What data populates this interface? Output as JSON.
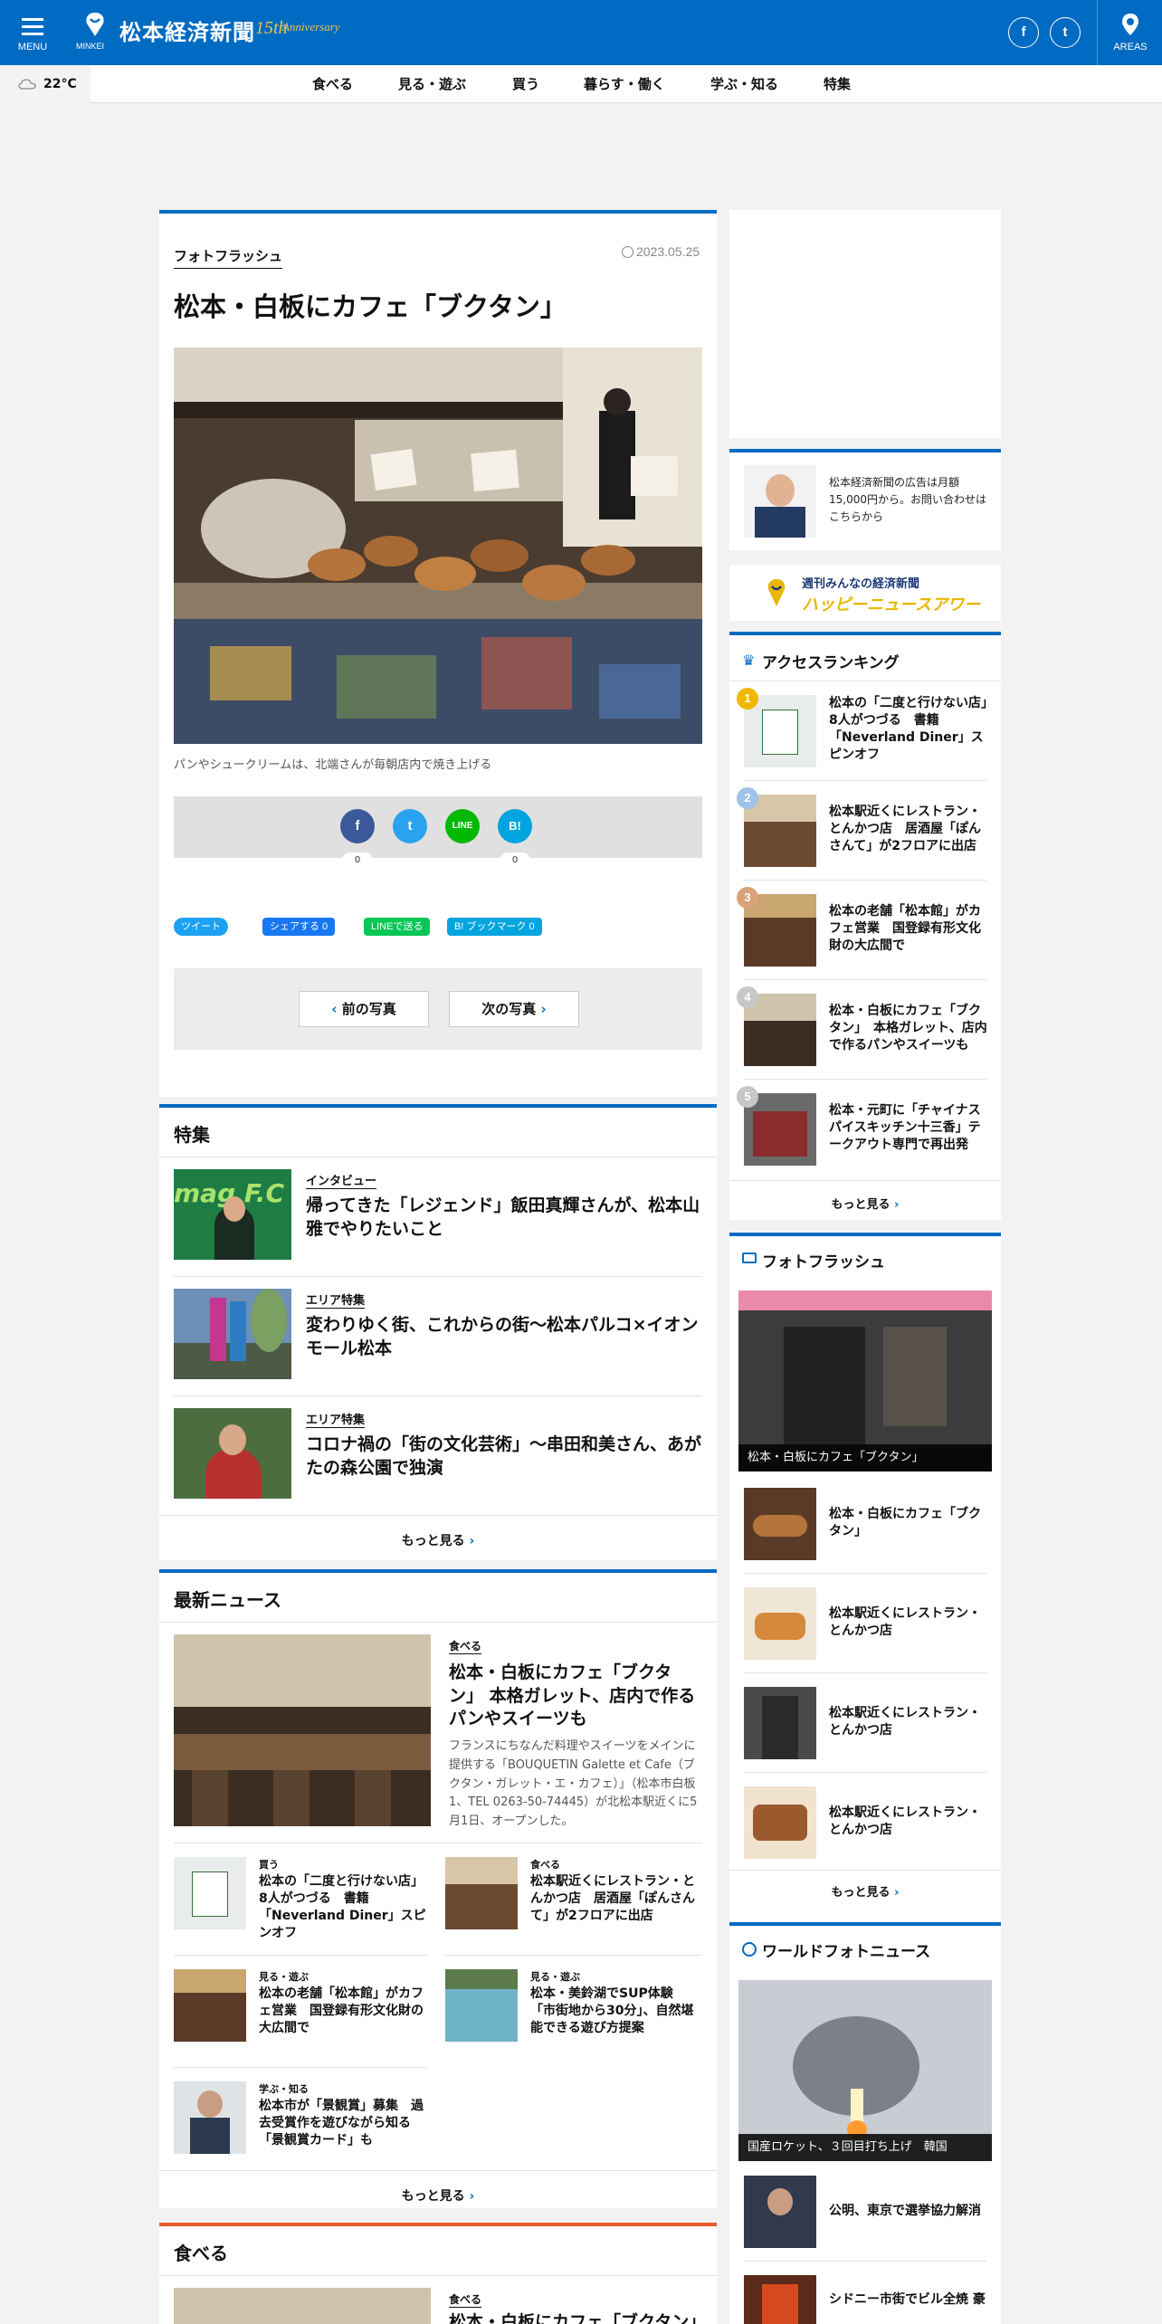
{
  "header": {
    "menu_label": "MENU",
    "brand": "MINKEI",
    "site_title": "松本経済新聞",
    "anniv_num": "15th",
    "anniv_text": "Anniversary",
    "facebook": "f",
    "twitter": "t",
    "areas_label": "AREAS",
    "color": "#006bc2"
  },
  "nav": {
    "weather": "22°C",
    "items": [
      "食べる",
      "見る・遊ぶ",
      "買う",
      "暮らす・働く",
      "学ぶ・知る",
      "特集"
    ]
  },
  "article": {
    "kicker": "フォトフラッシュ",
    "date": "2023.05.25",
    "title": "松本・白板にカフェ「ブクタン」",
    "caption": "パンやシュークリームは、北端さんが毎朝店内で焼き上げる",
    "share": {
      "facebook": "f",
      "twitter": "t",
      "line": "LINE",
      "hatena": "B!",
      "fb_count": "0",
      "hatena_count": "0"
    },
    "chips": {
      "tweet": "ツイート",
      "fb_share": "シェアする 0",
      "line_send": "LINEで送る",
      "bookmark": "B! ブックマーク  0"
    },
    "prev_label": "前の写真",
    "next_label": "次の写真"
  },
  "tokushu": {
    "title": "特集",
    "items": [
      {
        "tag": "インタビュー",
        "title": "帰ってきた「レジェンド」飯田真輝さんが、松本山雅でやりたいこと"
      },
      {
        "tag": "エリア特集",
        "title": "変わりゆく街、これからの街～松本パルコ×イオンモール松本"
      },
      {
        "tag": "エリア特集",
        "title": "コロナ禍の「街の文化芸術」～串田和美さん、あがたの森公園で独演"
      }
    ],
    "more": "もっと見る"
  },
  "news": {
    "title": "最新ニュース",
    "lead": {
      "tag": "食べる",
      "title": "松本・白板にカフェ「ブクタン」 本格ガレット、店内で作るパンやスイーツも",
      "body": "フランスにちなんだ料理やスイーツをメインに提供する「BOUQUETIN Galette et Cafe（ブクタン・ガレット・エ・カフェ）」（松本市白板1、TEL 0263-50-74445）が北松本駅近くに5月1日、オープンした。"
    },
    "grid": [
      {
        "tag": "買う",
        "title": "松本の「二度と行けない店」8人がつづる　書籍「Neverland Diner」スピンオフ"
      },
      {
        "tag": "食べる",
        "title": "松本駅近くにレストラン・とんかつ店　居酒屋「ぽんさんて」が2フロアに出店"
      },
      {
        "tag": "見る・遊ぶ",
        "title": "松本の老舗「松本館」がカフェ営業　国登録有形文化財の大広間で"
      },
      {
        "tag": "見る・遊ぶ",
        "title": "松本・美鈴湖でSUP体験　「市街地から30分」、自然堪能できる遊び方提案"
      },
      {
        "tag": "学ぶ・知る",
        "title": "松本市が「景観賞」募集　過去受賞作を遊びながら知る「景観賞カード」も"
      }
    ],
    "more": "もっと見る"
  },
  "taberu": {
    "title": "食べる",
    "tag": "食べる",
    "title2": "松本・白板にカフェ「ブクタン」"
  },
  "sidebar": {
    "ad_text": "松本経済新聞の広告は月額15,000円から。お問い合わせはこちらから",
    "banner_top": "週刊みんなの経済新聞",
    "banner_main": "ハッピーニュースアワー",
    "ranking": {
      "title": "アクセスランキング",
      "items": [
        {
          "rank": "1",
          "title": "松本の「二度と行けない店」8人がつづる　書籍「Neverland Diner」スピンオフ"
        },
        {
          "rank": "2",
          "title": "松本駅近くにレストラン・とんかつ店　居酒屋「ぽんさんて」が2フロアに出店"
        },
        {
          "rank": "3",
          "title": "松本の老舗「松本館」がカフェ営業　国登録有形文化財の大広間で"
        },
        {
          "rank": "4",
          "title": "松本・白板にカフェ「ブクタン」　本格ガレット、店内で作るパンやスイーツも"
        },
        {
          "rank": "5",
          "title": "松本・元町に「チャイナスパイスキッチン十三香」テークアウト専門で再出発"
        }
      ],
      "more": "もっと見る"
    },
    "photo": {
      "title": "フォトフラッシュ",
      "main_caption": "松本・白板にカフェ「ブクタン」",
      "items": [
        {
          "title": "松本・白板にカフェ「ブクタン」"
        },
        {
          "title": "松本駅近くにレストラン・とんかつ店"
        },
        {
          "title": "松本駅近くにレストラン・とんかつ店"
        },
        {
          "title": "松本駅近くにレストラン・とんかつ店"
        }
      ],
      "more": "もっと見る"
    },
    "world": {
      "title": "ワールドフォトニュース",
      "main_caption": "国産ロケット、３回目打ち上げ　韓国",
      "items": [
        {
          "title": "公明、東京で選挙協力解消"
        },
        {
          "title": "シドニー市街でビル全焼 豪"
        }
      ]
    }
  }
}
